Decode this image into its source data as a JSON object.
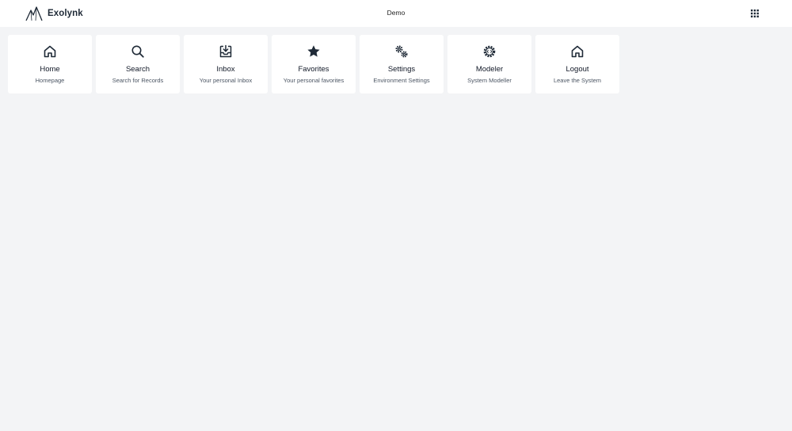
{
  "header": {
    "brand_name": "Exolynk",
    "environment": "Demo",
    "apps_icon": "grid-icon"
  },
  "tiles": [
    {
      "title": "Home",
      "subtitle": "Homepage",
      "icon": "home-icon"
    },
    {
      "title": "Search",
      "subtitle": "Search for Records",
      "icon": "search-icon"
    },
    {
      "title": "Inbox",
      "subtitle": "Your personal Inbox",
      "icon": "inbox-icon"
    },
    {
      "title": "Favorites",
      "subtitle": "Your personal favorites",
      "icon": "star-icon"
    },
    {
      "title": "Settings",
      "subtitle": "Environment Settings",
      "icon": "gears-icon"
    },
    {
      "title": "Modeler",
      "subtitle": "System Modeller",
      "icon": "gear-code-icon"
    },
    {
      "title": "Logout",
      "subtitle": "Leave the System",
      "icon": "home-icon"
    }
  ]
}
